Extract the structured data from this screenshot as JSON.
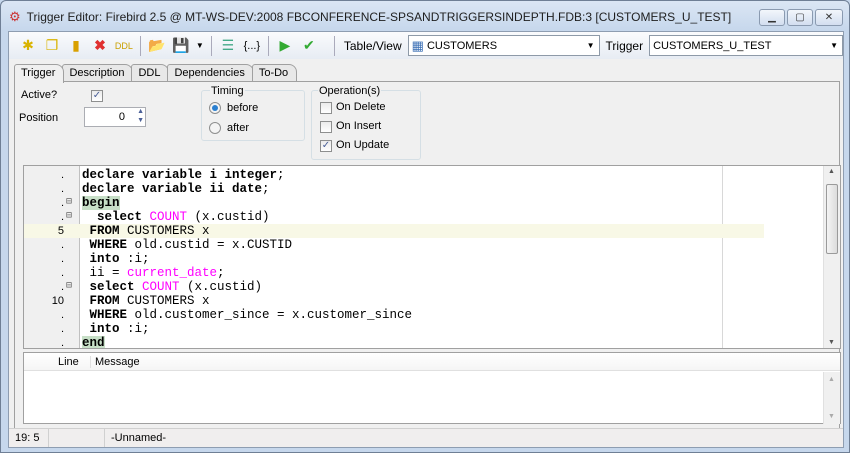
{
  "window": {
    "title": "Trigger Editor: Firebird 2.5 @ MT-WS-DEV:2008 FBCONFERENCE-SPSANDTRIGGERSINDEPTH.FDB:3 [CUSTOMERS_U_TEST]",
    "minimize": "▁",
    "maximize": "▢",
    "close": "✕"
  },
  "toolbar": {
    "table_view_label": "Table/View",
    "table_view_value": "CUSTOMERS",
    "trigger_label": "Trigger",
    "trigger_value": "CUSTOMERS_U_TEST"
  },
  "tabs": [
    "Trigger",
    "Description",
    "DDL",
    "Dependencies",
    "To-Do"
  ],
  "form": {
    "active_label": "Active?",
    "active_checked": true,
    "position_label": "Position",
    "position_value": "0",
    "timing": {
      "label": "Timing",
      "options": [
        "before",
        "after"
      ],
      "selected": "before"
    },
    "operations": {
      "label": "Operation(s)",
      "items": [
        {
          "label": "On Delete",
          "checked": false
        },
        {
          "label": "On Insert",
          "checked": false
        },
        {
          "label": "On Update",
          "checked": true
        }
      ]
    }
  },
  "editor": {
    "line_numbers": [
      ".",
      ".",
      ".",
      ".",
      "5",
      ".",
      ".",
      ".",
      ".",
      "10",
      ".",
      ".",
      "."
    ],
    "lines": [
      [
        {
          "t": "declare variable i integer",
          "c": "kw"
        },
        {
          "t": ";",
          "c": ""
        }
      ],
      [
        {
          "t": "declare variable ii date",
          "c": "kw"
        },
        {
          "t": ";",
          "c": ""
        }
      ],
      [
        {
          "t": "begin",
          "c": "kw grn"
        }
      ],
      [
        {
          "t": "  select ",
          "c": "kw"
        },
        {
          "t": "COUNT",
          "c": "fn"
        },
        {
          "t": " (x.custid)",
          "c": ""
        }
      ],
      [
        {
          "t": " FROM",
          "c": "kw"
        },
        {
          "t": " CUSTOMERS x",
          "c": ""
        }
      ],
      [
        {
          "t": " WHERE",
          "c": "kw"
        },
        {
          "t": " old.custid = x.CUSTID",
          "c": ""
        }
      ],
      [
        {
          "t": " into",
          "c": "kw"
        },
        {
          "t": " :i;",
          "c": ""
        }
      ],
      [
        {
          "t": " ii = ",
          "c": ""
        },
        {
          "t": "current_date",
          "c": "fn"
        },
        {
          "t": ";",
          "c": ""
        }
      ],
      [
        {
          "t": " select ",
          "c": "kw"
        },
        {
          "t": "COUNT",
          "c": "fn"
        },
        {
          "t": " (x.custid)",
          "c": ""
        }
      ],
      [
        {
          "t": " FROM",
          "c": "kw"
        },
        {
          "t": " CUSTOMERS x",
          "c": ""
        }
      ],
      [
        {
          "t": " WHERE",
          "c": "kw"
        },
        {
          "t": " old.customer_since = x.customer_since",
          "c": ""
        }
      ],
      [
        {
          "t": " into",
          "c": "kw"
        },
        {
          "t": " :i;",
          "c": ""
        }
      ],
      [
        {
          "t": "end",
          "c": "kw grn"
        }
      ]
    ]
  },
  "messages": {
    "columns": [
      "Line",
      "Message"
    ]
  },
  "status": {
    "position": "19:  5",
    "modified": "",
    "name": "-Unnamed-"
  }
}
